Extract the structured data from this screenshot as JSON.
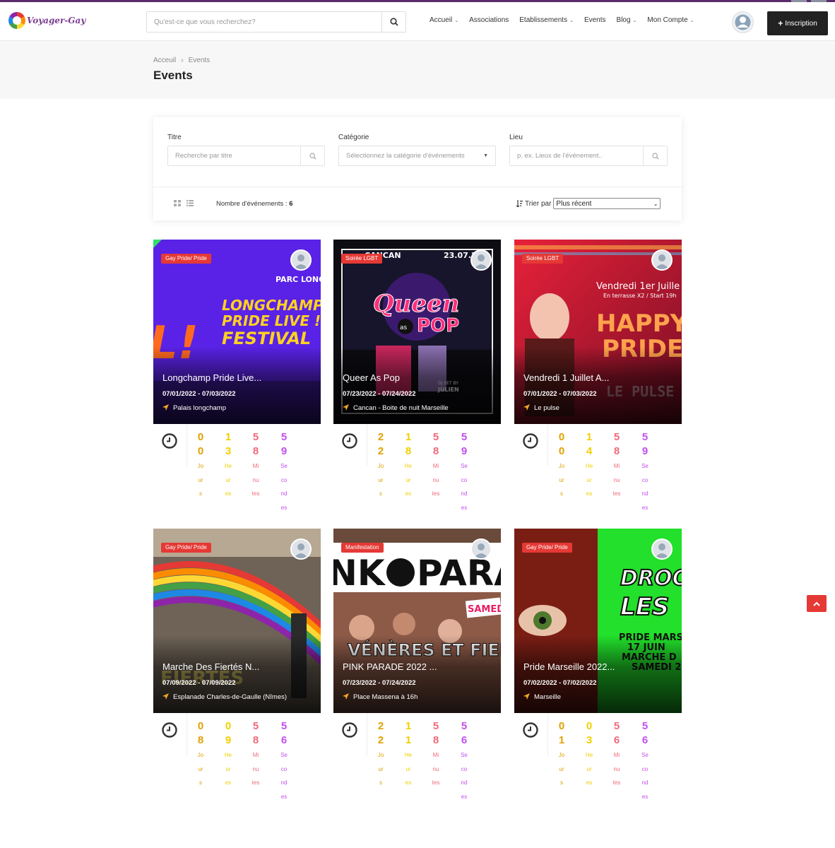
{
  "header": {
    "logo_text": "Voyager-Gay",
    "search_placeholder": "Qu'est-ce que vous recherchez?",
    "nav": {
      "accueil": "Accueil",
      "associations": "Associations",
      "etablissements": "Etablissements",
      "events": "Events",
      "blog": "Blog",
      "mon_compte": "Mon Compte"
    },
    "signup_label": "Inscription"
  },
  "breadcrumb": {
    "home": "Acceuil",
    "separator": "›",
    "current": "Events"
  },
  "page_title": "Events",
  "filters": {
    "title_label": "Titre",
    "title_placeholder": "Recherche par titre",
    "category_label": "Catégorie",
    "category_value": "Sélectionnez la catégorie d'événements",
    "location_label": "Lieu",
    "location_placeholder": "p. ex. Lieux de l'événement..",
    "count_label": "Nombre d'événements :",
    "count_value": "6",
    "sort_label": "Trier par",
    "sort_value": "Plus récent"
  },
  "countdown_labels": {
    "days": "Jours",
    "hours": "Heures",
    "minutes": "Minutes",
    "seconds": "Secondes"
  },
  "countdown_colors": {
    "days": "#e0a100",
    "hours": "#f0d000",
    "minutes": "#f06a7a",
    "seconds": "#c44ef0"
  },
  "accent_color": "#e53935",
  "events": [
    {
      "category": "Gay Pride/ Pride",
      "title": "Longchamp Pride Live...",
      "dates": "07/01/2022 - 07/03/2022",
      "place": "Palais longchamp",
      "days": "00",
      "hours": "13",
      "minutes": "58",
      "seconds": "59"
    },
    {
      "category": "Soirée LGBT",
      "title": "Queer As Pop",
      "dates": "07/23/2022 - 07/24/2022",
      "place": "Cancan - Boite de nuit Marseille",
      "days": "22",
      "hours": "18",
      "minutes": "58",
      "seconds": "59"
    },
    {
      "category": "Soirée LGBT",
      "title": "Vendredi 1 Juillet A...",
      "dates": "07/01/2022 - 07/03/2022",
      "place": "Le pulse",
      "days": "00",
      "hours": "14",
      "minutes": "58",
      "seconds": "59"
    },
    {
      "category": "Gay Pride/ Pride",
      "title": "Marche Des Fiertés N...",
      "dates": "07/09/2022 - 07/09/2022",
      "place": "Esplanade Charles-de-Gaulle (Nîmes)",
      "days": "08",
      "hours": "09",
      "minutes": "58",
      "seconds": "56"
    },
    {
      "category": "Manifestation",
      "title": "PINK PARADE 2022 ...",
      "dates": "07/23/2022 - 07/24/2022",
      "place": "Place Massena à 16h",
      "days": "22",
      "hours": "11",
      "minutes": "58",
      "seconds": "56"
    },
    {
      "category": "Gay Pride/ Pride",
      "title": "Pride Marseille 2022...",
      "dates": "07/02/2022 - 07/02/2022",
      "place": "Marseille",
      "days": "01",
      "hours": "03",
      "minutes": "56",
      "seconds": "56"
    }
  ]
}
